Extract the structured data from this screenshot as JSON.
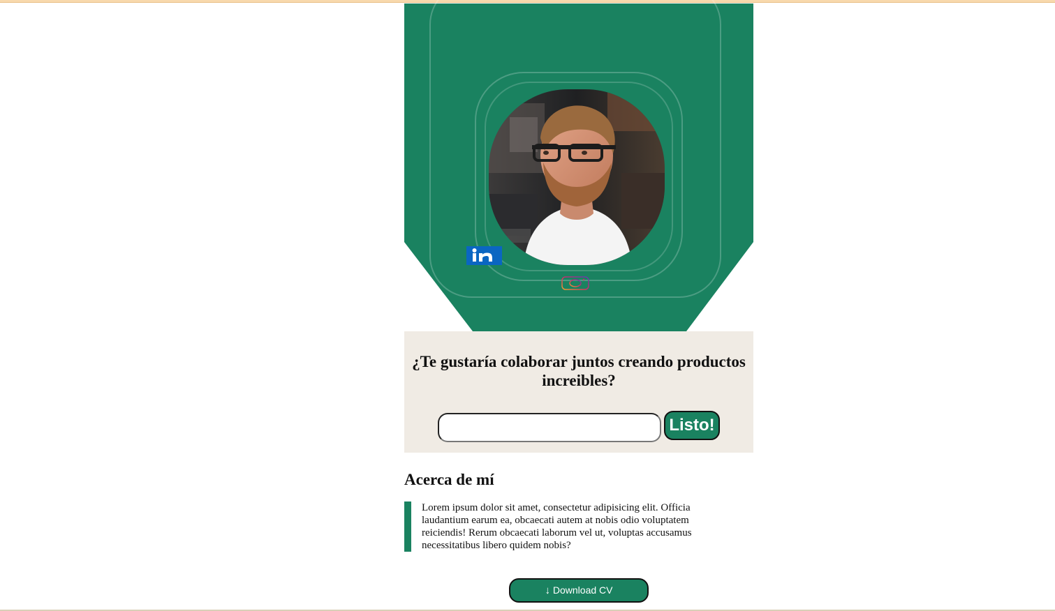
{
  "colors": {
    "primary_green": "#1a8260",
    "cta_background": "#f0ebe4",
    "top_border": "#f8d9ad"
  },
  "hero": {
    "avatar_icon": "avatar",
    "social_icons": [
      "linkedin-icon",
      "instagram-icon"
    ]
  },
  "cta": {
    "title": "¿Te gustaría colaborar juntos creando productos increibles?",
    "input_value": "",
    "input_placeholder": "",
    "submit_label": "Listo!"
  },
  "about": {
    "title": "Acerca de mí",
    "text": "Lorem ipsum dolor sit amet, consectetur adipisicing elit. Officia laudantium earum ea, obcaecati autem at nobis odio voluptatem reiciendis! Rerum obcaecati laborum vel ut, voluptas accusamus necessitatibus libero quidem nobis?"
  },
  "download": {
    "arrow": "↓",
    "label": "Download CV",
    "icon": "download-arrow-icon"
  }
}
